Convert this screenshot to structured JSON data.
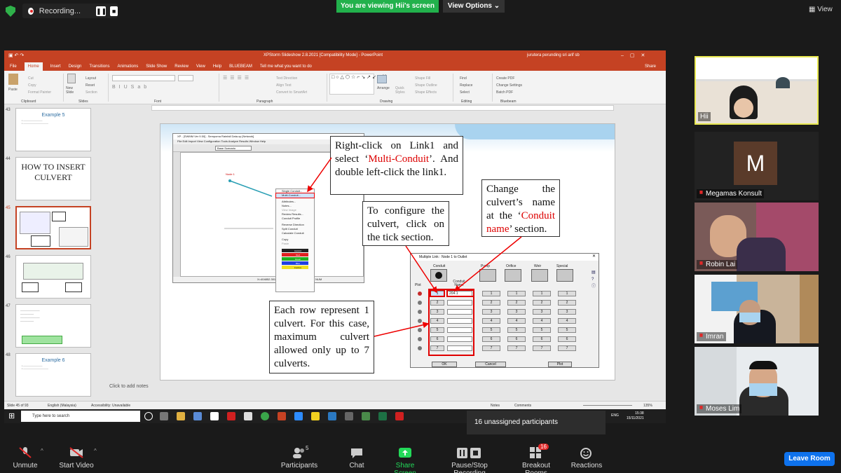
{
  "zoom": {
    "recording_label": "Recording...",
    "viewing_banner": "You are viewing Hii's screen",
    "view_options": "View Options",
    "view_label": "View",
    "unassigned": "16 unassigned participants",
    "leave_label": "Leave Room",
    "toolbar": {
      "unmute": "Unmute",
      "start_video": "Start Video",
      "participants": "Participants",
      "participants_count": "5",
      "chat": "Chat",
      "share_screen": "Share Screen",
      "pause_recording": "Pause/Stop Recording",
      "breakout_rooms": "Breakout Rooms",
      "breakout_badge": "16",
      "reactions": "Reactions"
    },
    "participants": [
      {
        "name": "Hii"
      },
      {
        "name": "Megamas Konsult",
        "initial": "M"
      },
      {
        "name": "Robin Lai"
      },
      {
        "name": "Imran"
      },
      {
        "name": "Moses Lim"
      }
    ]
  },
  "ppt": {
    "title": "XPStorm Slideshow 2.8.2021 [Compatibility Mode] - PowerPoint",
    "user": "jurutera perunding sri arif sb",
    "share": "Share",
    "menu": [
      "File",
      "Home",
      "Insert",
      "Design",
      "Transitions",
      "Animations",
      "Slide Show",
      "Review",
      "View",
      "Help",
      "BLUEBEAM",
      "Tell me what you want to do"
    ],
    "ribbon_groups": [
      "Clipboard",
      "Slides",
      "Font",
      "Paragraph",
      "Drawing",
      "Editing",
      "Bluebeam"
    ],
    "ribbon_items": {
      "paste": "Paste",
      "cut": "Cut",
      "copy": "Copy",
      "format_painter": "Format Painter",
      "new_slide": "New Slide",
      "layout": "Layout",
      "reset": "Reset",
      "section": "Section",
      "text_direction": "Text Direction",
      "align_text": "Align Text",
      "convert_smartart": "Convert to SmartArt",
      "arrange": "Arrange",
      "quick_styles": "Quick Styles",
      "shape_fill": "Shape Fill",
      "shape_outline": "Shape Outline",
      "shape_effects": "Shape Effects",
      "find": "Find",
      "replace": "Replace",
      "select": "Select",
      "create_pdf": "Create PDF",
      "change_settings": "Change Settings",
      "batch_pdf": "Batch PDF"
    },
    "thumbnails": [
      {
        "num": "43",
        "title": "Example 5"
      },
      {
        "num": "44",
        "title": "HOW TO INSERT CULVERT"
      },
      {
        "num": "45",
        "title": ""
      },
      {
        "num": "46",
        "title": ""
      },
      {
        "num": "47",
        "title": ""
      },
      {
        "num": "48",
        "title": "Example 6"
      }
    ],
    "notes_placeholder": "Click to add notes",
    "status": {
      "slide": "Slide 45 of 93",
      "language": "English (Malaysia)",
      "accessibility": "Accessibility: Unavailable",
      "notes": "Notes",
      "comments": "Comments",
      "zoom": "135%"
    }
  },
  "slide": {
    "callout1_a": "Right-click on Link1 and select ‘",
    "callout1_red": "Multi-Conduit",
    "callout1_b": "’. And double left-click the link1.",
    "callout2": "To configure the culvert, click on the tick section.",
    "callout3_a": "Change the culvert’s name at the ‘",
    "callout3_red": "Conduit name",
    "callout3_b": "’ section.",
    "callout4": "Each row represent 1 culvert. For this case, maximum culvert allowed only up to 7 culverts."
  },
  "xp": {
    "title": "XP - [SWMM Ver 9.50] - Sempoma Rainfall Data.xp [Network]",
    "menu": "File   Edit   Import   View   Configuration   Tools   Analyze   Results   Window   Help",
    "scenario": "Base Scenario",
    "node_label": "Node 1",
    "status_coords": "X=404852.301   Y=4743444.052   HDR   1.00:153   NUM",
    "context_menu": [
      "Single Conduit...",
      "Multi-Conduit...",
      "Attributes...",
      "Notes...",
      "View Image",
      "Review Results...",
      "Conduit Profile",
      "Reverse Direction",
      "Split Conduit",
      "Calculate Conduit",
      "Copy",
      "Paste"
    ],
    "swatches": [
      "Hazard",
      "Red",
      "Green",
      "Blue",
      "Inactive"
    ]
  },
  "dialog": {
    "title": "Multiple Link : Node 1 to Outlet",
    "headers": [
      "Conduit",
      "Pump",
      "Orifice",
      "Weir",
      "Special"
    ],
    "plot_label": "Plot",
    "conduit_name_label": "Conduit Name",
    "first_name": "204.1",
    "rows": [
      "1",
      "2",
      "3",
      "4",
      "5",
      "6",
      "7"
    ],
    "ok": "OK",
    "cancel": "Cancel",
    "plot_btn": "Plot"
  },
  "taskbar": {
    "search": "Type here to search",
    "lang": "ENG",
    "time": "15:38",
    "date": "15/11/2021"
  }
}
